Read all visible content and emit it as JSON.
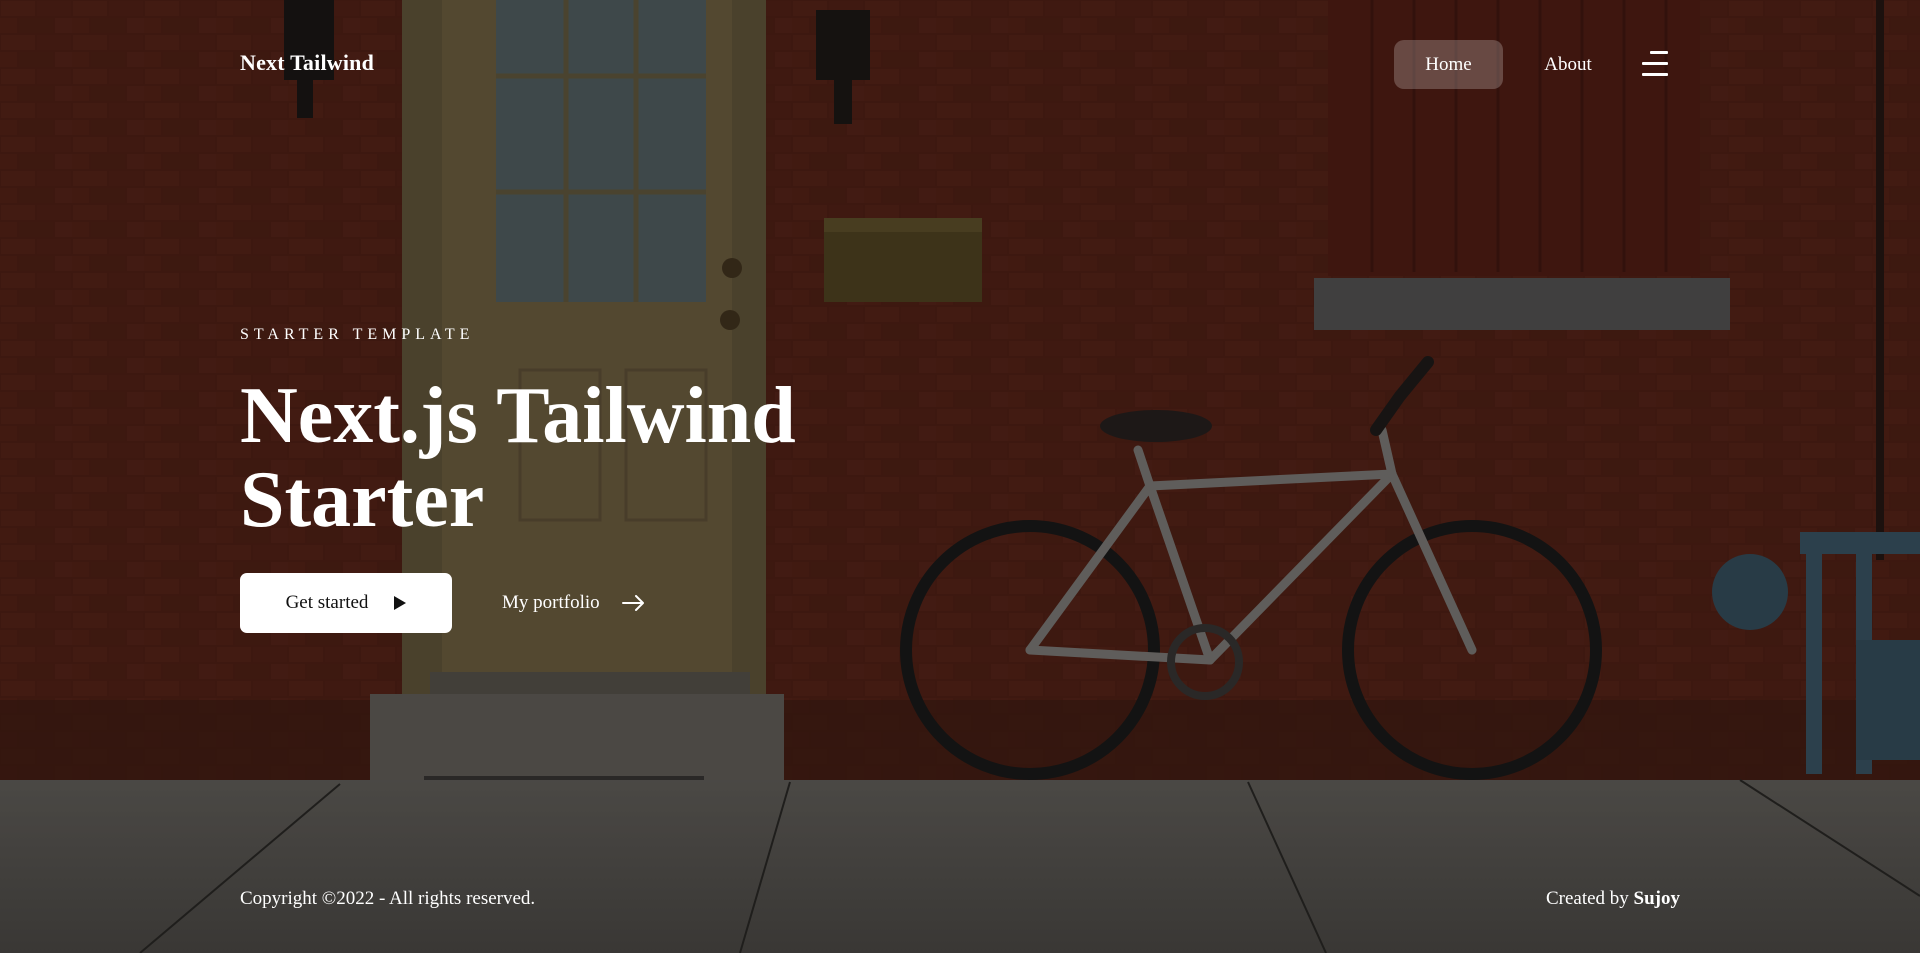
{
  "header": {
    "brand": "Next Tailwind",
    "nav": [
      {
        "label": "Home",
        "active": true
      },
      {
        "label": "About",
        "active": false
      }
    ],
    "menu_icon": "hamburger-menu-icon"
  },
  "hero": {
    "eyebrow": "STARTER TEMPLATE",
    "title_line1": "Next.js Tailwind",
    "title_line2": "Starter",
    "primary_button": {
      "label": "Get started",
      "icon": "play-icon"
    },
    "secondary_button": {
      "label": "My portfolio",
      "icon": "arrow-right-icon"
    }
  },
  "footer": {
    "copyright": "Copyright ©2022 - All rights reserved.",
    "credit_prefix": "Created by",
    "credit_name": "Sujoy"
  },
  "colors": {
    "text": "#ffffff",
    "button_bg": "#ffffff",
    "button_text": "#111111",
    "active_nav_bg": "rgba(255,255,255,0.22)",
    "brick": "#5e2518",
    "door": "#7b6a48"
  }
}
